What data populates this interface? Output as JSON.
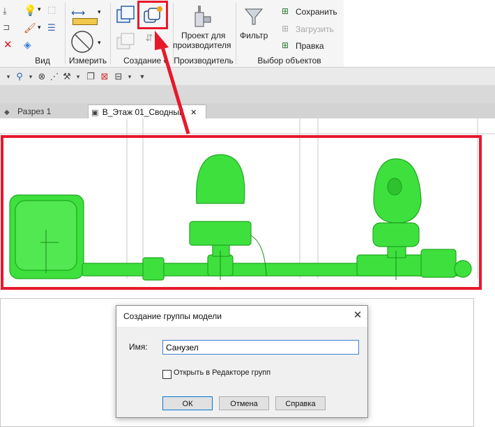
{
  "ribbon": {
    "panels": {
      "view": "Вид",
      "measure": "Измерить",
      "create": "Создание",
      "manufacturer": "Производитель",
      "selection": "Выбор объектов"
    },
    "buttons": {
      "manufacturer_project_line1": "Проект для",
      "manufacturer_project_line2": "производителя",
      "filter": "Фильтр",
      "save": "Сохранить",
      "load": "Загрузить",
      "edit": "Правка"
    },
    "create_dropdown": "▾"
  },
  "tabs": {
    "section": "Разрез 1",
    "active": "В_Этаж 01_Сводный",
    "close": "✕"
  },
  "dialog": {
    "title": "Создание группы модели",
    "close": "✕",
    "name_label": "Имя:",
    "name_value": "Санузел",
    "open_in_editor": "Открыть в Редакторе групп",
    "ok": "ОК",
    "cancel": "Отмена",
    "help": "Справка"
  },
  "colors": {
    "highlight": "#e8182b",
    "selection_green": "#3ee03e",
    "ribbon_bg": "#f5f5f5",
    "tab_bar": "#d3d3d3"
  }
}
